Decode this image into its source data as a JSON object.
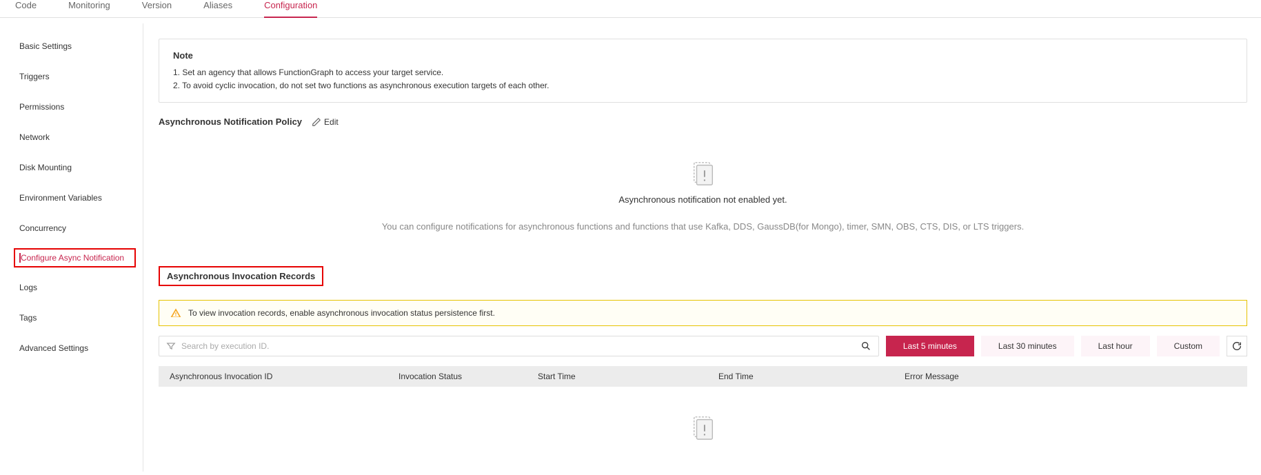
{
  "tabs": {
    "code": "Code",
    "monitoring": "Monitoring",
    "version": "Version",
    "aliases": "Aliases",
    "configuration": "Configuration"
  },
  "sidebar": {
    "basic": "Basic Settings",
    "triggers": "Triggers",
    "permissions": "Permissions",
    "network": "Network",
    "disk": "Disk Mounting",
    "env": "Environment Variables",
    "concurrency": "Concurrency",
    "async": "Configure Async Notification",
    "logs": "Logs",
    "tags": "Tags",
    "advanced": "Advanced Settings"
  },
  "note": {
    "title": "Note",
    "line1": "1. Set an agency that allows FunctionGraph to access your target service.",
    "line2": "2. To avoid cyclic invocation, do not set two functions as asynchronous execution targets of each other."
  },
  "policy": {
    "title": "Asynchronous Notification Policy",
    "edit": "Edit",
    "empty_text": "Asynchronous notification not enabled yet.",
    "empty_desc": "You can configure notifications for asynchronous functions and functions that use Kafka, DDS, GaussDB(for Mongo), timer, SMN, OBS, CTS, DIS, or LTS triggers."
  },
  "records": {
    "title": "Asynchronous Invocation Records",
    "warn": "To view invocation records, enable asynchronous invocation status persistence first.",
    "search_placeholder": "Search by execution ID.",
    "time": {
      "m5": "Last 5 minutes",
      "m30": "Last 30 minutes",
      "h1": "Last hour",
      "custom": "Custom"
    },
    "columns": {
      "id": "Asynchronous Invocation ID",
      "status": "Invocation Status",
      "start": "Start Time",
      "end": "End Time",
      "error": "Error Message"
    }
  }
}
